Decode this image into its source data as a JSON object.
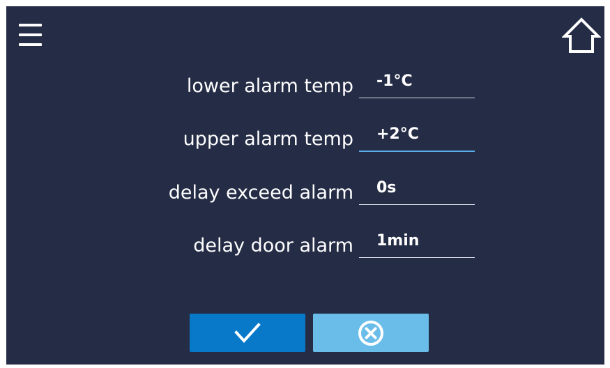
{
  "header": {
    "menu_icon": "hamburger-menu-icon",
    "home_icon": "home-icon"
  },
  "fields": [
    {
      "label": "lower alarm temp",
      "value": "-1°C",
      "active": false
    },
    {
      "label": "upper alarm temp",
      "value": "+2°C",
      "active": true
    },
    {
      "label": "delay exceed alarm",
      "value": "0s",
      "active": false
    },
    {
      "label": "delay door alarm",
      "value": "1min",
      "active": false
    }
  ],
  "buttons": {
    "confirm_icon": "checkmark-icon",
    "cancel_icon": "circle-x-icon"
  },
  "colors": {
    "background": "#252c46",
    "confirm": "#0879c9",
    "cancel": "#6bbde9",
    "active_underline": "#5aaee8"
  }
}
